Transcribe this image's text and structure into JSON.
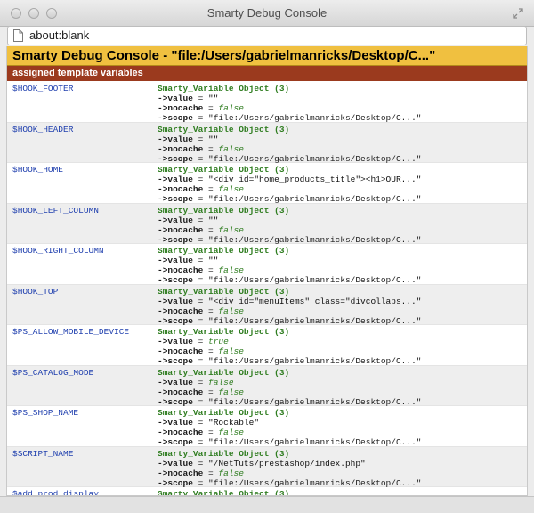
{
  "window": {
    "title": "Smarty Debug Console",
    "url": "about:blank"
  },
  "console": {
    "header": "Smarty Debug Console  -  \"file:/Users/gabrielmanricks/Desktop/C...\"",
    "section": "assigned template variables"
  },
  "variables": [
    {
      "name": "$HOOK_FOOTER",
      "object": "Smarty_Variable Object (3)",
      "value_prefix": "->value",
      "value": " = \"\"",
      "value_is_bool": false,
      "nocache": "false",
      "scope": "= \"file:/Users/gabrielmanricks/Desktop/C...\""
    },
    {
      "name": "$HOOK_HEADER",
      "object": "Smarty_Variable Object (3)",
      "value_prefix": "->value",
      "value": " = \"\"",
      "value_is_bool": false,
      "nocache": "false",
      "scope": "= \"file:/Users/gabrielmanricks/Desktop/C...\""
    },
    {
      "name": "$HOOK_HOME",
      "object": "Smarty_Variable Object (3)",
      "value_prefix": "->value",
      "value": " = \"<div id=\"home_products_title\"><h1>OUR...\"",
      "value_is_bool": false,
      "nocache": "false",
      "scope": "= \"file:/Users/gabrielmanricks/Desktop/C...\""
    },
    {
      "name": "$HOOK_LEFT_COLUMN",
      "object": "Smarty_Variable Object (3)",
      "value_prefix": "->value",
      "value": " = \"\"",
      "value_is_bool": false,
      "nocache": "false",
      "scope": "= \"file:/Users/gabrielmanricks/Desktop/C...\""
    },
    {
      "name": "$HOOK_RIGHT_COLUMN",
      "object": "Smarty_Variable Object (3)",
      "value_prefix": "->value",
      "value": " = \"\"",
      "value_is_bool": false,
      "nocache": "false",
      "scope": "= \"file:/Users/gabrielmanricks/Desktop/C...\""
    },
    {
      "name": "$HOOK_TOP",
      "object": "Smarty_Variable Object (3)",
      "value_prefix": "->value",
      "value": " = \"<div id=\"menuItems\" class=\"divcollaps...\"",
      "value_is_bool": false,
      "nocache": "false",
      "scope": "= \"file:/Users/gabrielmanricks/Desktop/C...\""
    },
    {
      "name": "$PS_ALLOW_MOBILE_DEVICE",
      "object": "Smarty_Variable Object (3)",
      "value_prefix": "->value",
      "value": "true",
      "value_is_bool": true,
      "nocache": "false",
      "scope": "= \"file:/Users/gabrielmanricks/Desktop/C...\""
    },
    {
      "name": "$PS_CATALOG_MODE",
      "object": "Smarty_Variable Object (3)",
      "value_prefix": "->value",
      "value": "false",
      "value_is_bool": true,
      "nocache": "false",
      "scope": "= \"file:/Users/gabrielmanricks/Desktop/C...\""
    },
    {
      "name": "$PS_SHOP_NAME",
      "object": "Smarty_Variable Object (3)",
      "value_prefix": "->value",
      "value": " = \"Rockable\"",
      "value_is_bool": false,
      "nocache": "false",
      "scope": "= \"file:/Users/gabrielmanricks/Desktop/C...\""
    },
    {
      "name": "$SCRIPT_NAME",
      "object": "Smarty_Variable Object (3)",
      "value_prefix": "->value",
      "value": " = \"/NetTuts/prestashop/index.php\"",
      "value_is_bool": false,
      "nocache": "false",
      "scope": "= \"file:/Users/gabrielmanricks/Desktop/C...\""
    },
    {
      "name": "$add_prod_display",
      "object": "Smarty_Variable Object (3)",
      "value_prefix": "",
      "value": "",
      "value_is_bool": false,
      "nocache": "",
      "scope": ""
    }
  ]
}
